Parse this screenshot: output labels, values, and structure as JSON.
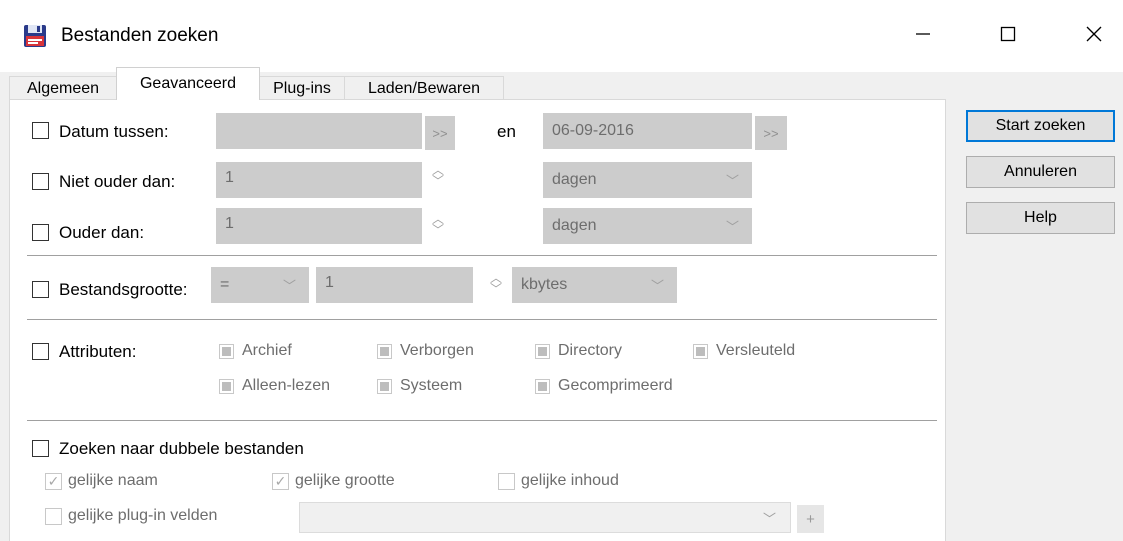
{
  "window": {
    "title": "Bestanden zoeken",
    "icon": "floppy-disk-icon",
    "controls": [
      "minimize-icon",
      "maximize-icon",
      "close-icon"
    ]
  },
  "tabs": [
    {
      "label": "Algemeen",
      "active": false
    },
    {
      "label": "Geavanceerd",
      "active": true
    },
    {
      "label": "Plug-ins",
      "active": false
    },
    {
      "label": "Laden/Bewaren",
      "active": false
    }
  ],
  "buttons": {
    "start": "Start zoeken",
    "cancel": "Annuleren",
    "help": "Help"
  },
  "date": {
    "between_label": "Datum tussen:",
    "from_value": "",
    "browse_label": ">>",
    "and_label": "en",
    "to_value": "06-09-2016",
    "not_older_label": "Niet ouder dan:",
    "not_older_value": "1",
    "not_older_unit": "dagen",
    "older_label": "Ouder dan:",
    "older_value": "1",
    "older_unit": "dagen"
  },
  "size": {
    "label": "Bestandsgrootte:",
    "operator": "=",
    "value": "1",
    "unit": "kbytes"
  },
  "attributes": {
    "label": "Attributen:",
    "items": [
      "Archief",
      "Verborgen",
      "Directory",
      "Versleuteld",
      "Alleen-lezen",
      "Systeem",
      "Gecomprimeerd"
    ]
  },
  "duplicates": {
    "label": "Zoeken naar dubbele bestanden",
    "same_name": "gelijke naam",
    "same_size": "gelijke grootte",
    "same_content": "gelijke inhoud",
    "same_plugin": "gelijke plug-in velden",
    "add_label": "+"
  },
  "colors": {
    "accent": "#0078d7",
    "disabled_field": "#cccccc",
    "disabled_text": "#6d6d6d"
  }
}
